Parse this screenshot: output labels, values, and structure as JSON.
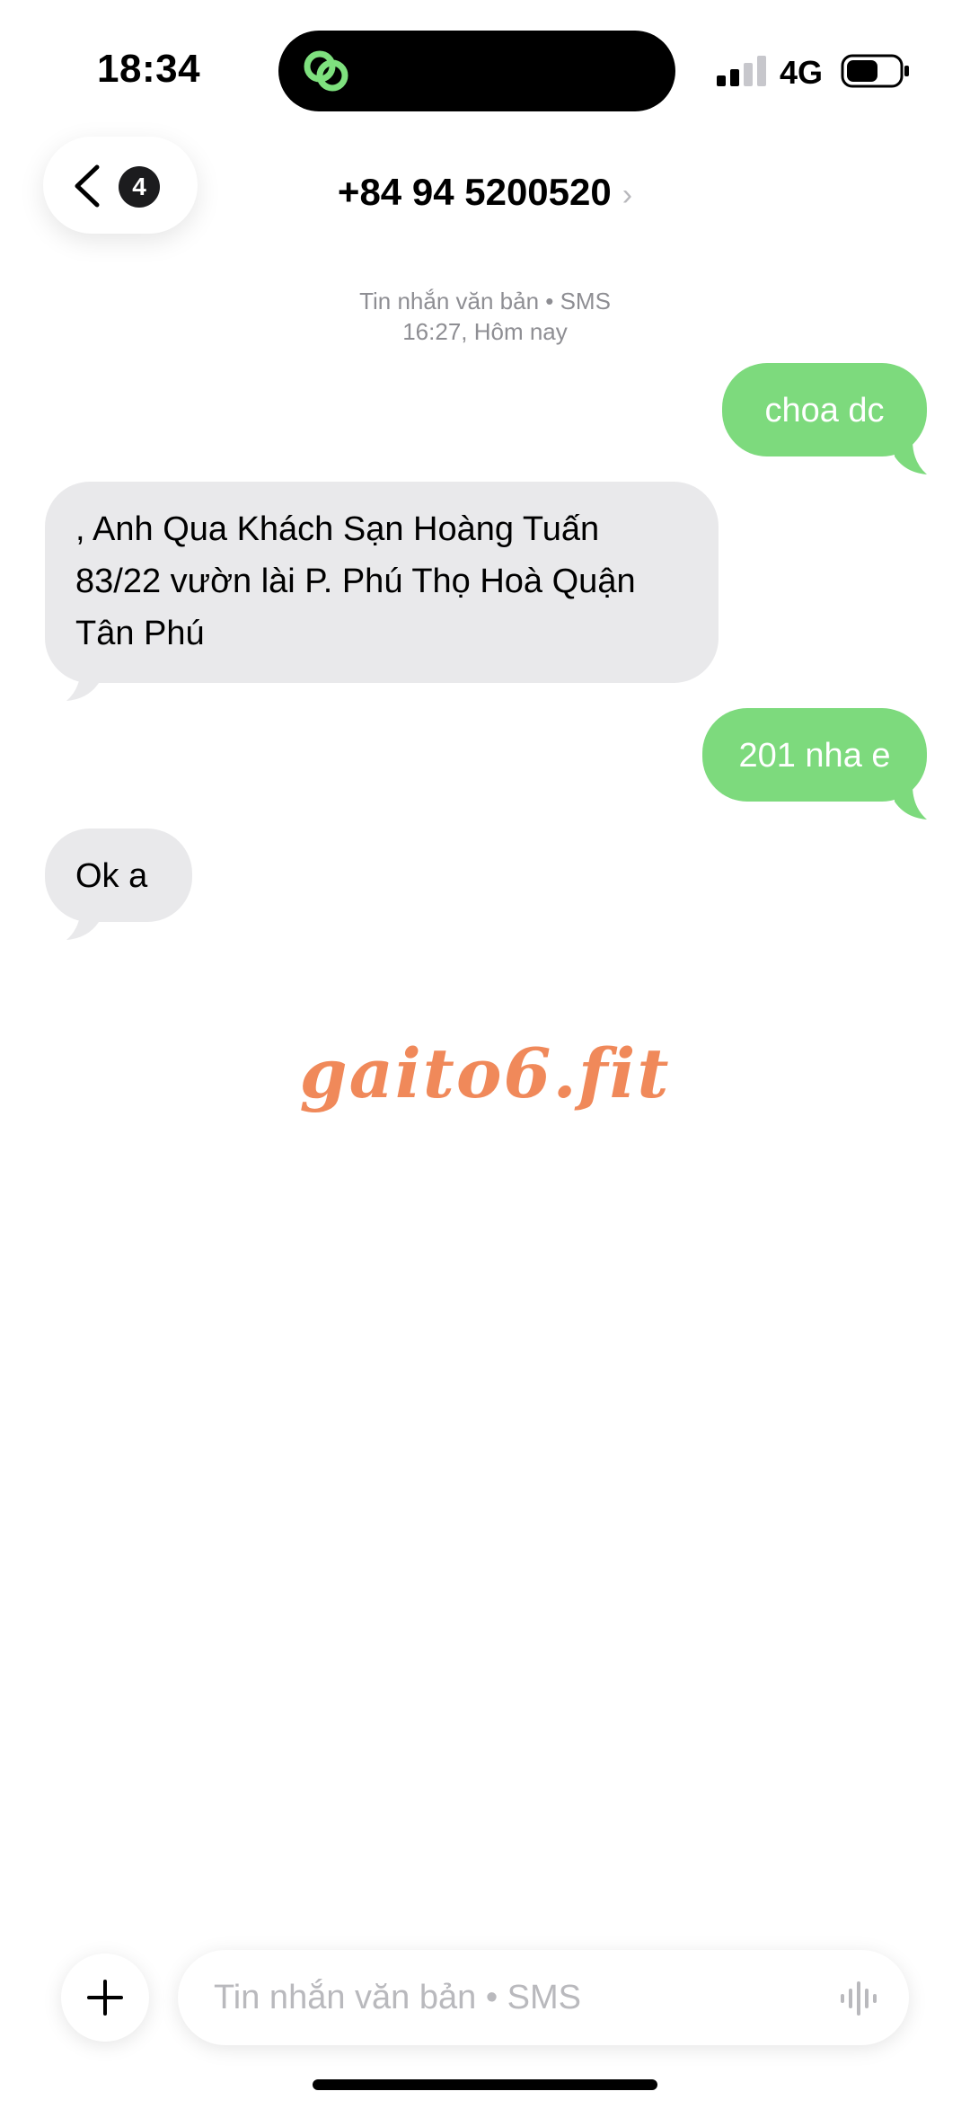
{
  "status_bar": {
    "time": "18:34",
    "network": "4G",
    "icons": [
      "link-icon",
      "signal-icon",
      "battery-icon"
    ]
  },
  "header": {
    "back_badge": "4",
    "contact": "+84 94 5200520",
    "chevron": "›"
  },
  "conversation": {
    "meta_line1": "Tin nhắn văn bản • SMS",
    "meta_line2": "16:27, Hôm nay",
    "messages": [
      {
        "direction": "outgoing",
        "text": "choa  dc"
      },
      {
        "direction": "incoming",
        "text": " , Anh Qua Khách Sạn Hoàng Tuấn 83/22 vườn lài P. Phú Thọ Hoà Quận Tân Phú"
      },
      {
        "direction": "outgoing",
        "text": "201 nha e"
      },
      {
        "direction": "incoming",
        "text": "Ok a"
      }
    ]
  },
  "watermark": "gaito6.fit",
  "composer": {
    "placeholder": "Tin nhắn văn bản • SMS",
    "icons": [
      "plus-icon",
      "waveform-icon"
    ]
  },
  "colors": {
    "outgoing_bubble": "#7dda7d",
    "incoming_bubble": "#e9e9eb",
    "watermark": "#f0895a",
    "island_icon": "#7ee07e"
  }
}
